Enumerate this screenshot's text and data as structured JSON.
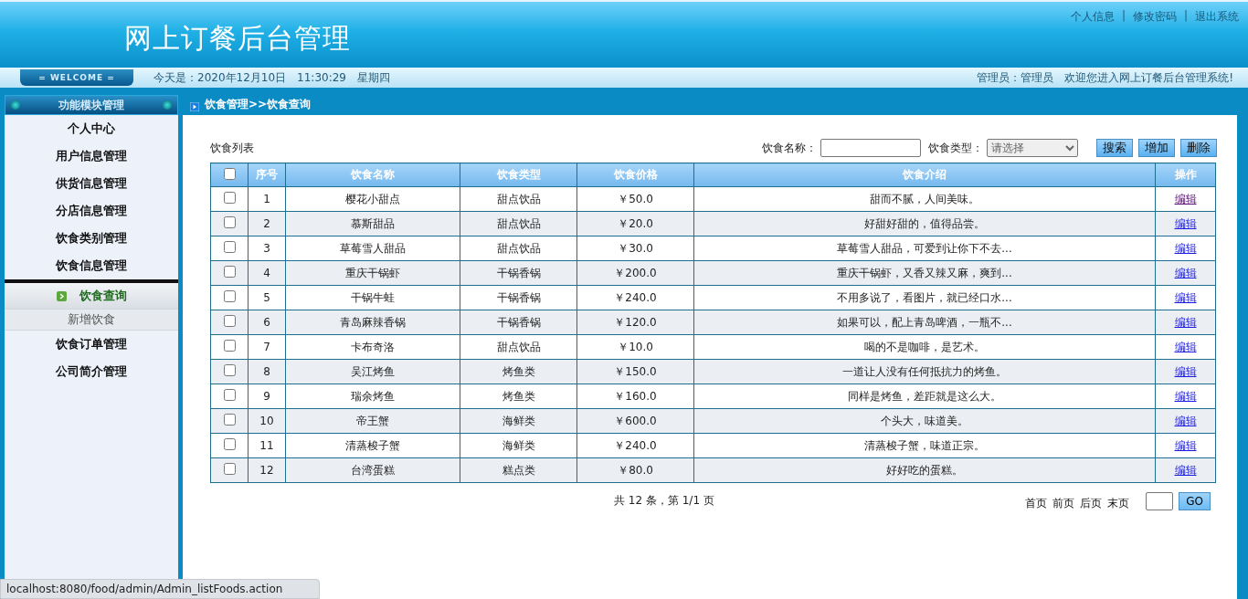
{
  "header": {
    "title": "网上订餐后台管理",
    "links": [
      "个人信息",
      "修改密码",
      "退出系统"
    ],
    "separators": [
      "|",
      "|"
    ]
  },
  "info_bar": {
    "welcome": "= WELCOME =",
    "today": "今天是：2020年12月10日　11:30:29　星期四",
    "admin": "管理员：管理员　欢迎您进入网上订餐后台管理系统!"
  },
  "sidebar": {
    "title": "功能模块管理",
    "items": [
      {
        "label": "个人中心"
      },
      {
        "label": "用户信息管理"
      },
      {
        "label": "供货信息管理"
      },
      {
        "label": "分店信息管理"
      },
      {
        "label": "饮食类别管理"
      },
      {
        "label": "饮食信息管理",
        "children": [
          {
            "label": "饮食查询",
            "selected": true
          },
          {
            "label": "新增饮食",
            "selected": false
          }
        ]
      },
      {
        "label": "饮食订单管理"
      },
      {
        "label": "公司简介管理"
      }
    ]
  },
  "breadcrumb": "饮食管理>>饮食查询",
  "list_title": "饮食列表",
  "filters": {
    "name_label": "饮食名称：",
    "type_label": "饮食类型：",
    "type_placeholder": "请选择",
    "buttons": [
      "搜索",
      "增加",
      "删除"
    ]
  },
  "table": {
    "columns": [
      "序号",
      "饮食名称",
      "饮食类型",
      "饮食价格",
      "饮食介绍",
      "操作"
    ],
    "select_all_checked": false,
    "rows": [
      {
        "cells": [
          "1",
          "樱花小甜点",
          "甜点饮品",
          "￥50.0",
          "甜而不腻，人间美味。"
        ],
        "action": "编辑",
        "visited": true,
        "checked": false
      },
      {
        "cells": [
          "2",
          "慕斯甜品",
          "甜点饮品",
          "￥20.0",
          "好甜好甜的，值得品尝。"
        ],
        "action": "编辑",
        "visited": false,
        "checked": false
      },
      {
        "cells": [
          "3",
          "草莓雪人甜品",
          "甜点饮品",
          "￥30.0",
          "草莓雪人甜品，可爱到让你下不去..."
        ],
        "action": "编辑",
        "visited": false,
        "checked": false
      },
      {
        "cells": [
          "4",
          "重庆干锅虾",
          "干锅香锅",
          "￥200.0",
          "重庆干锅虾，又香又辣又麻，爽到..."
        ],
        "action": "编辑",
        "visited": false,
        "checked": false
      },
      {
        "cells": [
          "5",
          "干锅牛蛙",
          "干锅香锅",
          "￥240.0",
          "不用多说了，看图片，就已经口水..."
        ],
        "action": "编辑",
        "visited": false,
        "checked": false
      },
      {
        "cells": [
          "6",
          "青岛麻辣香锅",
          "干锅香锅",
          "￥120.0",
          "如果可以，配上青岛啤酒，一瓶不..."
        ],
        "action": "编辑",
        "visited": false,
        "checked": false
      },
      {
        "cells": [
          "7",
          "卡布奇洛",
          "甜点饮品",
          "￥10.0",
          "喝的不是咖啡，是艺术。"
        ],
        "action": "编辑",
        "visited": false,
        "checked": false
      },
      {
        "cells": [
          "8",
          "吴江烤鱼",
          "烤鱼类",
          "￥150.0",
          "一道让人没有任何抵抗力的烤鱼。"
        ],
        "action": "编辑",
        "visited": false,
        "checked": false
      },
      {
        "cells": [
          "9",
          "瑞余烤鱼",
          "烤鱼类",
          "￥160.0",
          "同样是烤鱼，差距就是这么大。"
        ],
        "action": "编辑",
        "visited": false,
        "checked": false
      },
      {
        "cells": [
          "10",
          "帝王蟹",
          "海鲜类",
          "￥600.0",
          "个头大，味道美。"
        ],
        "action": "编辑",
        "visited": false,
        "checked": false
      },
      {
        "cells": [
          "11",
          "清蒸梭子蟹",
          "海鲜类",
          "￥240.0",
          "清蒸梭子蟹，味道正宗。"
        ],
        "action": "编辑",
        "visited": false,
        "checked": false
      },
      {
        "cells": [
          "12",
          "台湾蛋糕",
          "糕点类",
          "￥80.0",
          "好好吃的蛋糕。"
        ],
        "action": "编辑",
        "visited": false,
        "checked": false
      }
    ]
  },
  "pagination": {
    "summary": "共 12 条，第 1/1 页",
    "links": [
      "首页",
      "前页",
      "后页",
      "末页"
    ],
    "go": "GO"
  },
  "status_bar": "localhost:8080/food/admin/Admin_listFoods.action"
}
